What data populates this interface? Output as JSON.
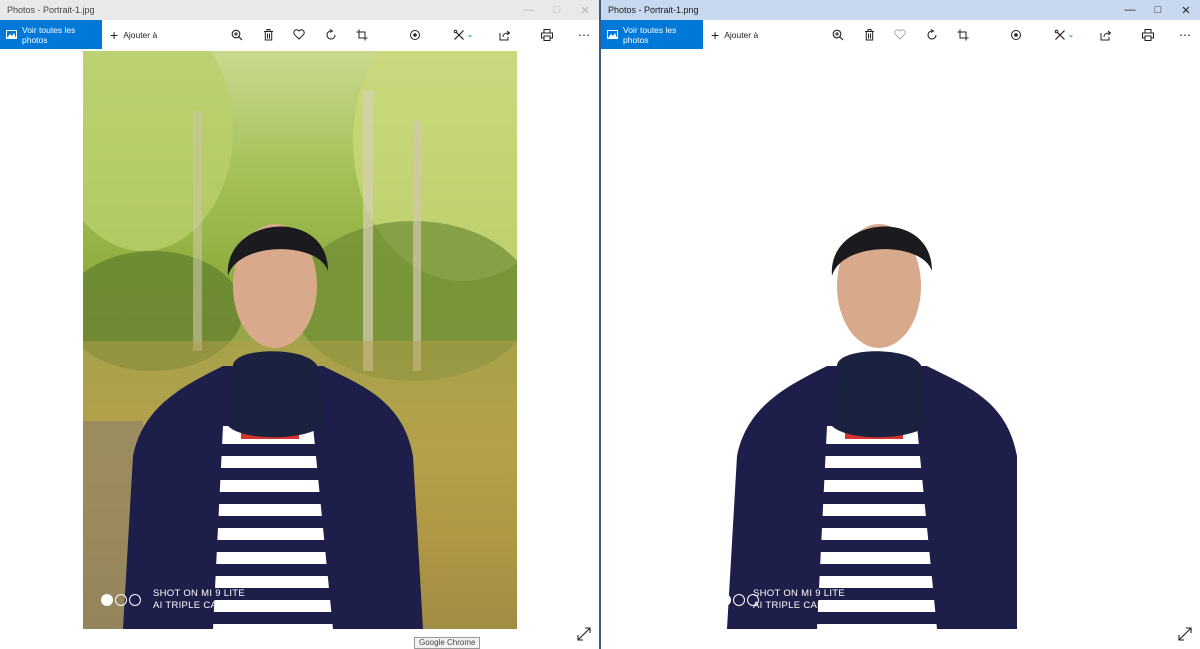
{
  "windows": [
    {
      "title": "Photos - Portrait-1.jpg",
      "toolbar": {
        "voir_label": "Voir toutes les photos",
        "ajouter_label": "Ajouter à"
      },
      "caption": {
        "line1": "SHOT ON MI 9 LITE",
        "line2": "AI TRIPLE CAMERA"
      }
    },
    {
      "title": "Photos - Portrait-1.png",
      "toolbar": {
        "voir_label": "Voir toutes les photos",
        "ajouter_label": "Ajouter à"
      },
      "caption": {
        "line1": "SHOT ON MI 9 LITE",
        "line2": "AI TRIPLE CAMERA"
      }
    }
  ],
  "tooltip": "Google Chrome",
  "icons": [
    "photos-icon",
    "plus-icon",
    "zoom-icon",
    "delete-icon",
    "favorite-icon",
    "rotate-icon",
    "crop-icon",
    "enhance-icon",
    "edit-icon",
    "share-icon",
    "print-icon",
    "more-icon",
    "expand-icon"
  ],
  "colors": {
    "accent": "#0078d7",
    "active_titlebar": "#c7d8ef",
    "inactive_titlebar": "#e9e9e9"
  }
}
